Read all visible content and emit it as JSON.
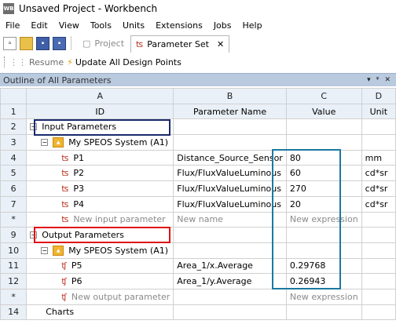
{
  "window": {
    "app_icon": "WB",
    "title": "Unsaved Project - Workbench"
  },
  "menu": [
    "File",
    "Edit",
    "View",
    "Tools",
    "Units",
    "Extensions",
    "Jobs",
    "Help"
  ],
  "toolbar": {
    "icons": [
      "new-icon",
      "open-icon",
      "save-icon",
      "save-as-icon"
    ],
    "tabs": [
      {
        "label": "Project",
        "state": "inactive",
        "icon": "project-icon"
      },
      {
        "label": "Parameter Set",
        "state": "active",
        "icon": "parameter-set-icon",
        "close": "✕"
      }
    ]
  },
  "actions": [
    {
      "label": "Resume",
      "icon": "resume-icon",
      "enabled": false
    },
    {
      "label": "Update All Design Points",
      "icon": "lightning-icon",
      "enabled": true
    }
  ],
  "panel": {
    "title": "Outline of All Parameters",
    "controls": [
      "▾",
      "ᵠ",
      "✕"
    ]
  },
  "grid": {
    "column_letters": [
      "A",
      "B",
      "C",
      "D"
    ],
    "column_names": [
      "ID",
      "Parameter Name",
      "Value",
      "Unit"
    ],
    "rows": [
      {
        "num": "2",
        "kind": "group",
        "label": "Input Parameters"
      },
      {
        "num": "3",
        "kind": "system",
        "label": "My SPEOS System (A1)"
      },
      {
        "num": "4",
        "kind": "param",
        "id": "P1",
        "name": "Distance_Source_Sensor",
        "value": "80",
        "unit": "mm"
      },
      {
        "num": "5",
        "kind": "param",
        "id": "P2",
        "name": "Flux/FluxValueLuminous",
        "value": "60",
        "unit": "cd*sr"
      },
      {
        "num": "6",
        "kind": "param",
        "id": "P3",
        "name": "Flux/FluxValueLuminous",
        "value": "270",
        "unit": "cd*sr"
      },
      {
        "num": "7",
        "kind": "param",
        "id": "P4",
        "name": "Flux/FluxValueLuminous",
        "value": "20",
        "unit": "cd*sr"
      },
      {
        "num": "*",
        "kind": "new",
        "id": "New input parameter",
        "name": "New name",
        "value": "New expression",
        "unit": ""
      },
      {
        "num": "9",
        "kind": "group",
        "label": "Output Parameters"
      },
      {
        "num": "10",
        "kind": "system",
        "label": "My SPEOS System (A1)"
      },
      {
        "num": "11",
        "kind": "param",
        "id": "P5",
        "name": "Area_1/x.Average",
        "value": "0.29768",
        "unit": ""
      },
      {
        "num": "12",
        "kind": "param",
        "id": "P6",
        "name": "Area_1/y.Average",
        "value": "0.26943",
        "unit": ""
      },
      {
        "num": "*",
        "kind": "new",
        "id": "New output parameter",
        "name": "",
        "value": "New expression",
        "unit": ""
      },
      {
        "num": "14",
        "kind": "charts",
        "label": "Charts"
      }
    ]
  },
  "colors": {
    "panel_header": "#b9c9de",
    "header_cells": "#eaf0f7",
    "highlight_input": "#1a2a6c",
    "highlight_output": "#e01010",
    "highlight_values": "#1a7aa0"
  }
}
